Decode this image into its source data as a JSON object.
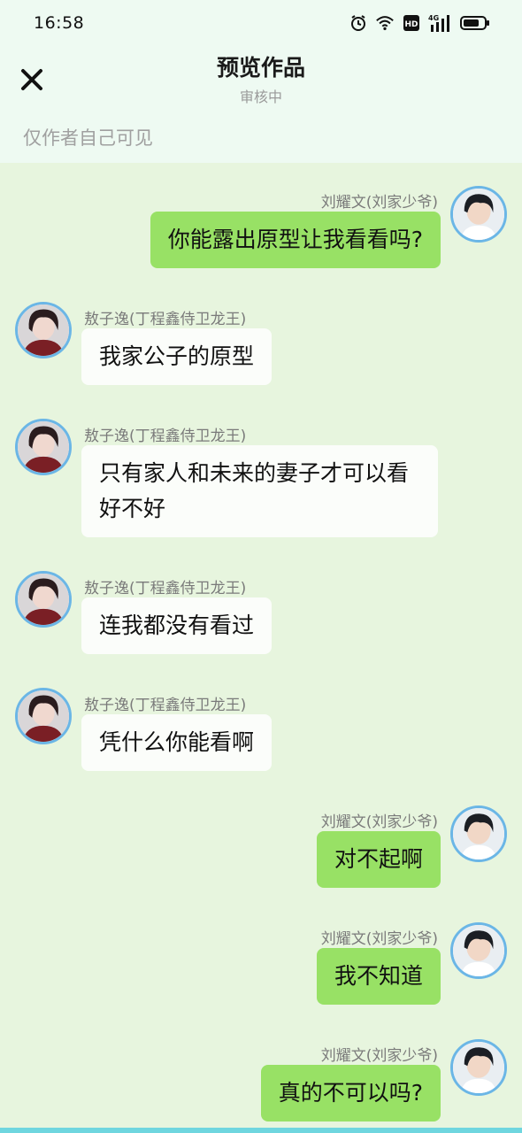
{
  "status_bar": {
    "time": "16:58",
    "icons": [
      "alarm-icon",
      "wifi-icon",
      "hd-icon",
      "signal-4g-icon",
      "battery-icon"
    ],
    "network_label": "4G",
    "hd_label": "HD"
  },
  "header": {
    "title": "预览作品",
    "subtitle": "审核中",
    "visibility_note": "仅作者自己可见",
    "close_icon": "close-icon"
  },
  "colors": {
    "background": "#e7f5de",
    "header_bg": "#eefaf2",
    "right_bubble": "#98e165",
    "left_bubble": "#fbfdfa",
    "avatar_border": "#6bb6e6"
  },
  "messages": [
    {
      "side": "right",
      "sender": "刘耀文(刘家少爷)",
      "text": "你能露出原型让我看看吗?"
    },
    {
      "side": "left",
      "sender": "敖子逸(丁程鑫侍卫龙王)",
      "text": "我家公子的原型"
    },
    {
      "side": "left",
      "sender": "敖子逸(丁程鑫侍卫龙王)",
      "text": "只有家人和未来的妻子才可以看好不好"
    },
    {
      "side": "left",
      "sender": "敖子逸(丁程鑫侍卫龙王)",
      "text": "连我都没有看过"
    },
    {
      "side": "left",
      "sender": "敖子逸(丁程鑫侍卫龙王)",
      "text": "凭什么你能看啊"
    },
    {
      "side": "right",
      "sender": "刘耀文(刘家少爷)",
      "text": "对不起啊"
    },
    {
      "side": "right",
      "sender": "刘耀文(刘家少爷)",
      "text": "我不知道"
    },
    {
      "side": "right",
      "sender": "刘耀文(刘家少爷)",
      "text": "真的不可以吗?"
    }
  ]
}
